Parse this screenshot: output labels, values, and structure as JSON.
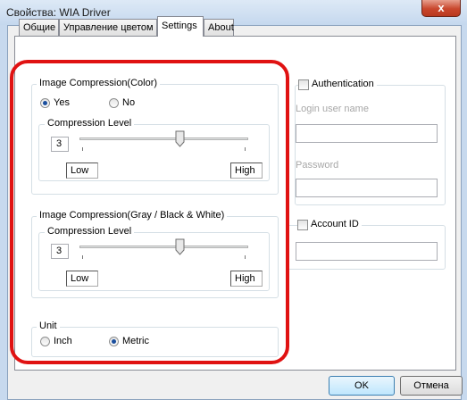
{
  "window": {
    "title": "Свойства: WIA Driver",
    "close_glyph": "x"
  },
  "tabs": [
    {
      "label": "Общие"
    },
    {
      "label": "Управление цветом"
    },
    {
      "label": "Settings"
    },
    {
      "label": "About"
    }
  ],
  "color_group": {
    "title": "Image Compression(Color)",
    "yes_label": "Yes",
    "no_label": "No",
    "selected": "Yes",
    "level_title": "Compression Level",
    "level_value": "3",
    "slider_level": 0.6,
    "low_label": "Low",
    "high_label": "High"
  },
  "gray_group": {
    "title": "Image Compression(Gray / Black & White)",
    "level_title": "Compression Level",
    "level_value": "3",
    "slider_level": 0.6,
    "low_label": "Low",
    "high_label": "High"
  },
  "unit_group": {
    "title": "Unit",
    "inch_label": "Inch",
    "metric_label": "Metric",
    "selected": "Metric"
  },
  "auth_group": {
    "title": "Authentication",
    "checked": false,
    "login_label": "Login user name",
    "login_value": "",
    "password_label": "Password",
    "password_value": ""
  },
  "account_group": {
    "title": "Account ID",
    "checked": false,
    "value": ""
  },
  "buttons": {
    "ok": "OK",
    "cancel": "Отмена"
  },
  "annotation": {
    "color": "#e01212"
  }
}
